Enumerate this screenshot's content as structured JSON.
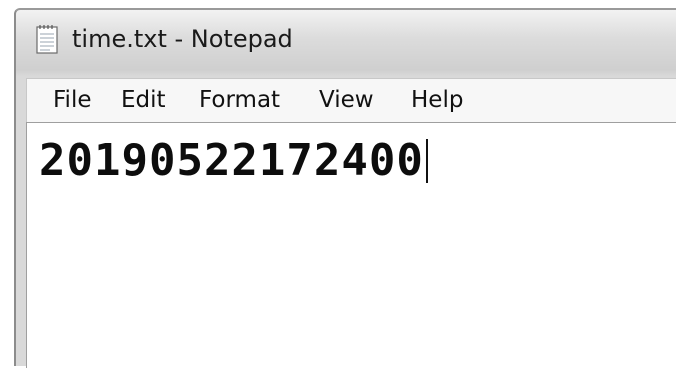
{
  "window": {
    "title": "time.txt - Notepad"
  },
  "menu": {
    "items": [
      {
        "label": "File"
      },
      {
        "label": "Edit"
      },
      {
        "label": "Format"
      },
      {
        "label": "View"
      },
      {
        "label": "Help"
      }
    ]
  },
  "editor": {
    "content": "20190522172400"
  },
  "icons": {
    "app": "notepad-document-icon"
  }
}
